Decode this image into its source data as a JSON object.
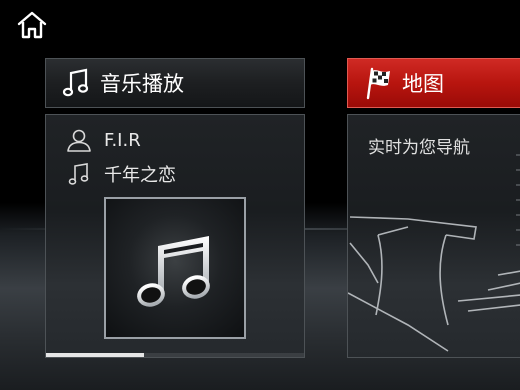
{
  "icons": {
    "home": "home-icon",
    "music_note": "music-note-icon",
    "person": "person-icon",
    "flag": "checkered-flag-icon"
  },
  "colors": {
    "accent_red": "#c4170f",
    "text": "#ffffff",
    "border": "#4d5256"
  },
  "music": {
    "title": "音乐播放",
    "artist": "F.I.R",
    "song": "千年之恋",
    "progress": 0.38
  },
  "map": {
    "title": "地图",
    "subtitle": "实时为您导航"
  }
}
